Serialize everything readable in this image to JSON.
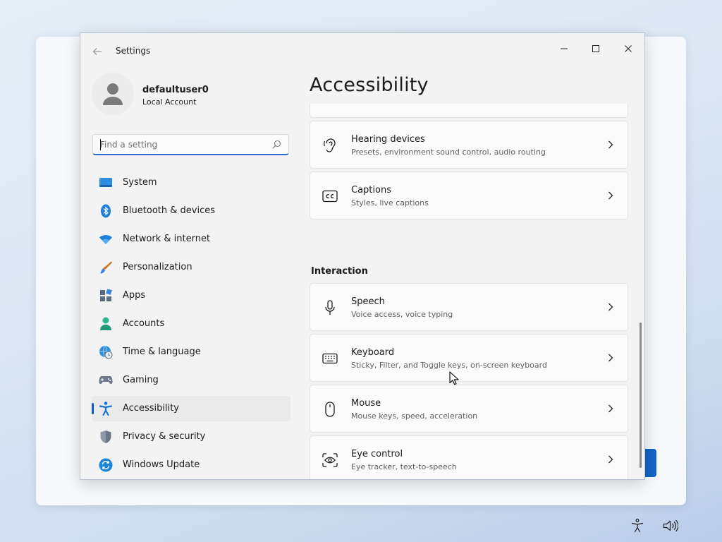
{
  "window": {
    "title": "Settings"
  },
  "profile": {
    "name": "defaultuser0",
    "account_type": "Local Account"
  },
  "search": {
    "placeholder": "Find a setting"
  },
  "nav": {
    "items": [
      {
        "label": "System",
        "icon": "system-icon"
      },
      {
        "label": "Bluetooth & devices",
        "icon": "bluetooth-icon"
      },
      {
        "label": "Network & internet",
        "icon": "wifi-icon"
      },
      {
        "label": "Personalization",
        "icon": "brush-icon"
      },
      {
        "label": "Apps",
        "icon": "apps-icon"
      },
      {
        "label": "Accounts",
        "icon": "accounts-icon"
      },
      {
        "label": "Time & language",
        "icon": "globe-clock-icon"
      },
      {
        "label": "Gaming",
        "icon": "gamepad-icon"
      },
      {
        "label": "Accessibility",
        "icon": "accessibility-icon",
        "selected": true
      },
      {
        "label": "Privacy & security",
        "icon": "shield-icon"
      },
      {
        "label": "Windows Update",
        "icon": "update-icon"
      }
    ]
  },
  "page": {
    "title": "Accessibility",
    "cards_top": [
      {
        "title": "Hearing devices",
        "description": "Presets, environment sound control, audio routing",
        "icon": "ear-icon"
      },
      {
        "title": "Captions",
        "description": "Styles, live captions",
        "icon": "captions-icon"
      }
    ],
    "section_interaction": "Interaction",
    "cards_interaction": [
      {
        "title": "Speech",
        "description": "Voice access, voice typing",
        "icon": "microphone-icon"
      },
      {
        "title": "Keyboard",
        "description": "Sticky, Filter, and Toggle keys, on-screen keyboard",
        "icon": "keyboard-icon"
      },
      {
        "title": "Mouse",
        "description": "Mouse keys, speed, acceleration",
        "icon": "mouse-icon"
      },
      {
        "title": "Eye control",
        "description": "Eye tracker, text-to-speech",
        "icon": "eye-control-icon"
      }
    ]
  },
  "colors": {
    "accent": "#0f5cc9",
    "window_bg": "#f3f3f3",
    "card_bg": "#fbfbfb"
  }
}
